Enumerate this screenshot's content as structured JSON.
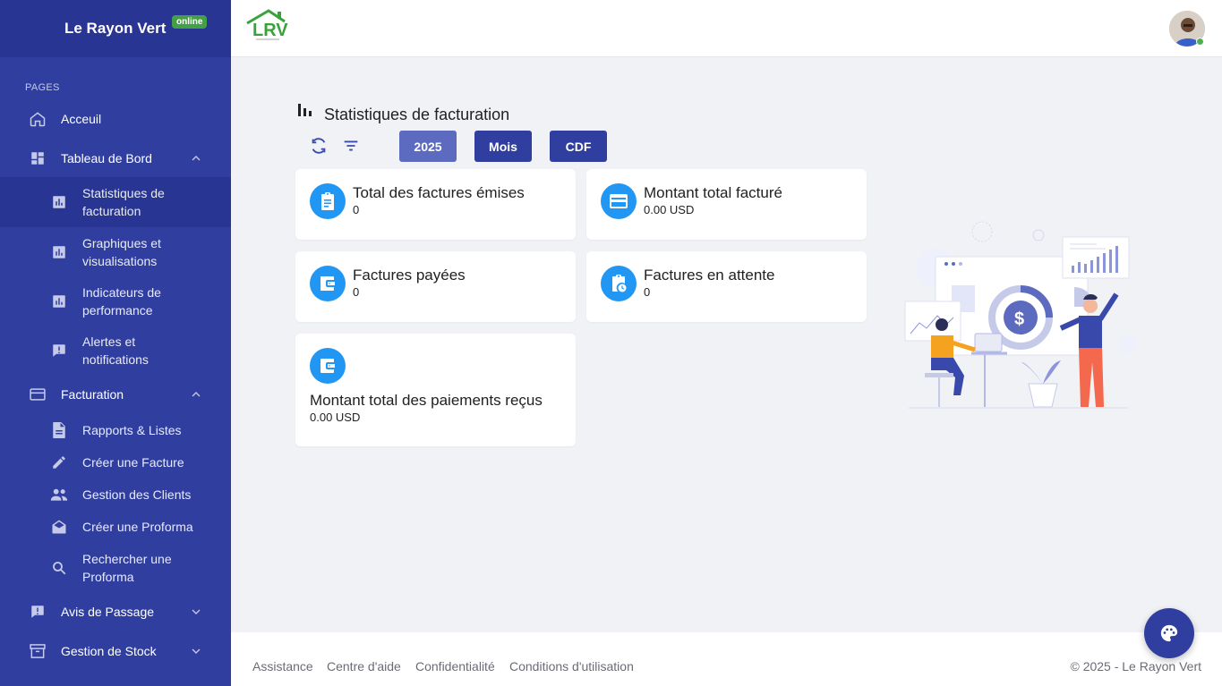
{
  "brand": {
    "title": "Le Rayon Vert",
    "status": "online",
    "logo_text": "LRV"
  },
  "sidebar": {
    "section_label": "PAGES",
    "items": [
      {
        "label": "Acceuil",
        "icon": "home-icon"
      },
      {
        "label": "Tableau de Bord",
        "icon": "dashboard-icon",
        "expanded": true
      },
      {
        "label": "Statistiques de facturation",
        "icon": "bar-chart-icon",
        "active": true
      },
      {
        "label": "Graphiques et visualisations",
        "icon": "bar-chart-icon"
      },
      {
        "label": "Indicateurs de performance",
        "icon": "bar-chart-icon"
      },
      {
        "label": "Alertes et notifications",
        "icon": "alert-message-icon"
      },
      {
        "label": "Facturation",
        "icon": "credit-card-icon",
        "expanded": true
      },
      {
        "label": "Rapports & Listes",
        "icon": "document-icon"
      },
      {
        "label": "Créer une Facture",
        "icon": "pencil-icon"
      },
      {
        "label": "Gestion des Clients",
        "icon": "people-icon"
      },
      {
        "label": "Créer une Proforma",
        "icon": "envelope-icon"
      },
      {
        "label": "Rechercher une Proforma",
        "icon": "search-icon"
      },
      {
        "label": "Avis de Passage",
        "icon": "alert-message-icon",
        "expanded": false
      },
      {
        "label": "Gestion de Stock",
        "icon": "archive-icon",
        "expanded": false
      }
    ]
  },
  "page": {
    "title": "Statistiques de facturation",
    "filters": {
      "year": "2025",
      "period": "Mois",
      "currency": "CDF"
    }
  },
  "cards": [
    {
      "title": "Total des factures émises",
      "value": "0",
      "icon": "clipboard-icon"
    },
    {
      "title": "Montant total facturé",
      "value": "0.00 USD",
      "icon": "credit-card-icon"
    },
    {
      "title": "Factures payées",
      "value": "0",
      "icon": "wallet-icon"
    },
    {
      "title": "Factures en attente",
      "value": "0",
      "icon": "pending-clipboard-icon"
    },
    {
      "title": "Montant total des paiements reçus",
      "value": "0.00 USD",
      "icon": "wallet-icon"
    }
  ],
  "footer": {
    "links": [
      "Assistance",
      "Centre d'aide",
      "Confidentialité",
      "Conditions d'utilisation"
    ],
    "copyright": "© 2025 - Le Rayon Vert"
  },
  "colors": {
    "sidebar": "#303f9f",
    "brand_bar": "#283593",
    "accent": "#2196f3",
    "chip_light": "#5c6bc0",
    "chip_dark": "#303f9f",
    "online": "#43a047"
  }
}
